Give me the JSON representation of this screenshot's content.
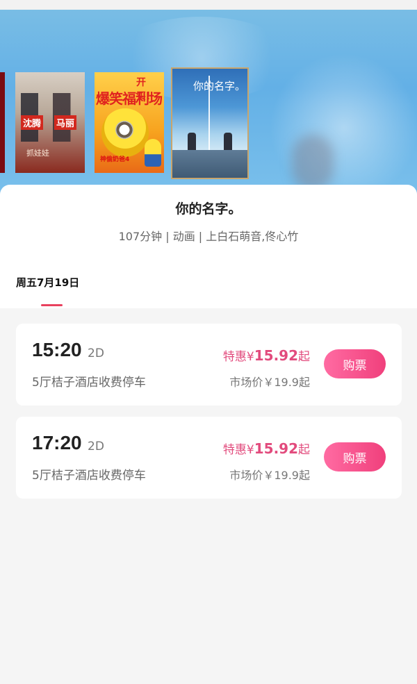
{
  "movie": {
    "title": "你的名字。",
    "meta": "107分钟 | 动画 | 上白石萌音,佟心竹"
  },
  "posters": [
    {
      "name": "partial-poster",
      "texts": []
    },
    {
      "name": "poster-shen-teng-ma-li",
      "texts": [
        "沈腾",
        "马丽",
        "抓娃娃"
      ]
    },
    {
      "name": "poster-minions",
      "texts": [
        "开买！",
        "爆笑福利场",
        "神偷奶爸4"
      ]
    },
    {
      "name": "poster-your-name",
      "texts": [
        "你的名字。"
      ],
      "selected": true
    }
  ],
  "date_tab": {
    "label": "周五7月19日"
  },
  "showtimes": [
    {
      "time": "15:20",
      "format": "2D",
      "hall": "5厅桔子酒店收费停车",
      "promo_prefix": "特惠¥",
      "promo_price": "15.92",
      "promo_suffix": "起",
      "market_price": "市场价￥19.9起",
      "buy_label": "购票"
    },
    {
      "time": "17:20",
      "format": "2D",
      "hall": "5厅桔子酒店收费停车",
      "promo_prefix": "特惠¥",
      "promo_price": "15.92",
      "promo_suffix": "起",
      "market_price": "市场价￥19.9起",
      "buy_label": "购票"
    }
  ],
  "colors": {
    "accent": "#e8415e",
    "promo": "#e24b7d",
    "buy_button": "#f0407c"
  }
}
